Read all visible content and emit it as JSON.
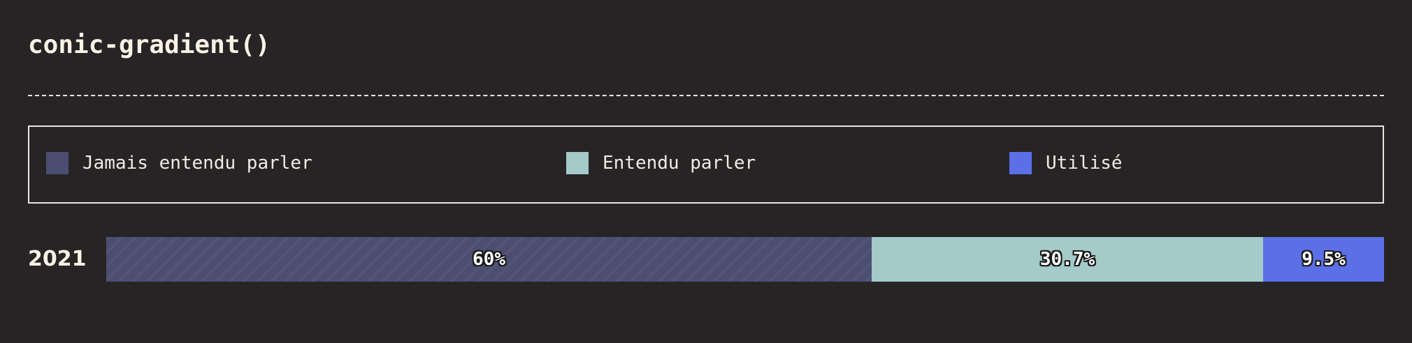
{
  "title": "conic-gradient()",
  "legend": [
    {
      "label": "Jamais entendu parler",
      "color": "#4b4e70"
    },
    {
      "label": "Entendu parler",
      "color": "#a4caca"
    },
    {
      "label": "Utilisé",
      "color": "#5b6fe6"
    }
  ],
  "chart_data": {
    "type": "bar",
    "stacked": true,
    "normalized": true,
    "title": "conic-gradient()",
    "categories": [
      "2021"
    ],
    "series": [
      {
        "name": "Jamais entendu parler",
        "values": [
          60
        ],
        "label": "60%",
        "color": "#4b4e70",
        "pattern": "diagonal-stripes"
      },
      {
        "name": "Entendu parler",
        "values": [
          30.7
        ],
        "label": "30.7%",
        "color": "#a4caca"
      },
      {
        "name": "Utilisé",
        "values": [
          9.5
        ],
        "label": "9.5%",
        "color": "#5b6fe6"
      }
    ],
    "xlim": [
      0,
      100
    ],
    "legend_position": "top",
    "grid": false
  }
}
